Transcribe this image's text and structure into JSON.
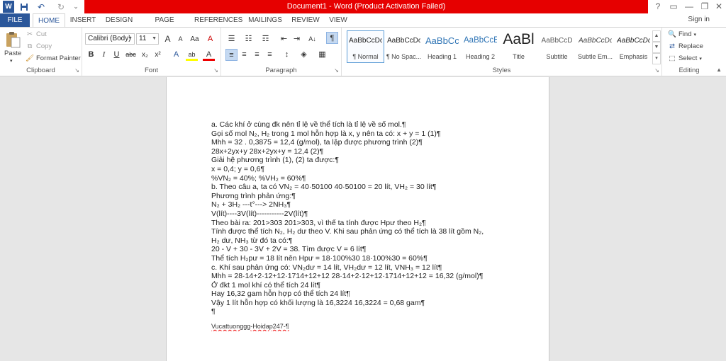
{
  "window": {
    "title": "Document1 - Word (Product Activation Failed)",
    "help": "?",
    "minimize": "—",
    "restore": "❐",
    "close": "✕",
    "ribbon_options": "▭"
  },
  "quick_access": {
    "word_icon": "W",
    "save_icon": "💾",
    "undo_icon": "↶",
    "redo_icon": "↻",
    "customize_icon": "⌄"
  },
  "tabs": [
    "FILE",
    "HOME",
    "INSERT",
    "DESIGN",
    "PAGE LAYOUT",
    "REFERENCES",
    "MAILINGS",
    "REVIEW",
    "VIEW"
  ],
  "signin": "Sign in",
  "clipboard": {
    "label": "Clipboard",
    "paste": "Paste",
    "cut": "Cut",
    "copy": "Copy",
    "format_painter": "Format Painter"
  },
  "font": {
    "label": "Font",
    "name": "Calibri (Body)",
    "size": "11",
    "grow": "A",
    "shrink": "A",
    "case": "Aa",
    "clear": "A",
    "bold": "B",
    "italic": "I",
    "underline": "U",
    "strike": "abc",
    "subscript": "x₂",
    "superscript": "x²",
    "effects": "A",
    "highlight": "ab",
    "color": "A"
  },
  "paragraph": {
    "label": "Paragraph",
    "bullets": "☰",
    "numbering": "☷",
    "multilevel": "☶",
    "decrease_indent": "⇤",
    "increase_indent": "⇥",
    "sort": "A↓",
    "show_marks": "¶",
    "align_left": "≡",
    "center": "≡",
    "align_right": "≡",
    "justify": "≡",
    "line_spacing": "↕",
    "shading": "◈",
    "borders": "▦"
  },
  "styles": {
    "label": "Styles",
    "items": [
      {
        "preview": "AaBbCcDc",
        "name": "¶ Normal"
      },
      {
        "preview": "AaBbCcDc",
        "name": "¶ No Spac..."
      },
      {
        "preview": "AaBbCc",
        "name": "Heading 1"
      },
      {
        "preview": "AaBbCcE",
        "name": "Heading 2"
      },
      {
        "preview": "AaBl",
        "name": "Title"
      },
      {
        "preview": "AaBbCcD",
        "name": "Subtitle"
      },
      {
        "preview": "AaBbCcDd",
        "name": "Subtle Em..."
      },
      {
        "preview": "AaBbCcDd",
        "name": "Emphasis"
      }
    ]
  },
  "editing": {
    "label": "Editing",
    "find": "Find",
    "replace": "Replace",
    "select": "Select"
  },
  "document": {
    "lines": [
      "a. Các khí ở cùng đk nên tỉ lệ về thể tích là tỉ lệ về số mol.¶",
      "Gọi số mol N₂, H₂ trong 1 mol hỗn hợp là x, y nên ta có: x + y = 1 (1)¶",
      "Mhh = 32 . 0,3875 = 12,4 (g/mol), ta lập được phương trình (2)¶",
      "28x+2yx+y 28x+2yx+y = 12,4 (2)¶",
      "Giải hệ phương trình (1), (2) ta được:¶",
      "x = 0,4; y = 0,6¶",
      "%VN₂ = 40%; %VH₂ = 60%¶",
      "b. Theo câu a, ta có VN₂ = 40·50100 40·50100 = 20 lít, VH₂ = 30 lít¶",
      "Phương trình phản ứng:¶",
      "N₂ + 3H₂ ---t°---> 2NH₃¶",
      "V(lít)----3V(lít)-----------2V(lít)¶",
      "Theo bài ra: 201>303 201>303, vì thế ta tính được Hpư theo H₂¶",
      "Tính được thể tích N₂, H₂ dư theo V. Khi sau phản ứng có thể tích là 38 lít gồm N₂,",
      "H₂ dư, NH₃ từ đó ta có:¶",
      "20 - V + 30 - 3V + 2V = 38. Tìm được V = 6 lít¶",
      "Thể tích H₂pư = 18 lít nên Hpư = 18·100%30 18·100%30 = 60%¶",
      "c. Khí sau phản ứng có: VN₂dư = 14 lít, VH₂dư = 12 lít, VNH₃ = 12 lít¶",
      "Mhh = 28·14+2·12+12·1714+12+12 28·14+2·12+12·1714+12+12 = 16,32 (g/mol)¶",
      "Ở đkt 1 mol khí có thể tích 24 lít¶",
      "Hay 16,32 gam hỗn hợp có thể tích 24 lít¶",
      "Vậy 1 lít hỗn hợp có khối lượng là 16,3224 16,3224 = 0,68 gam¶",
      "¶"
    ],
    "footer_note": "Vucattuonggg-Hoidap247-¶"
  }
}
